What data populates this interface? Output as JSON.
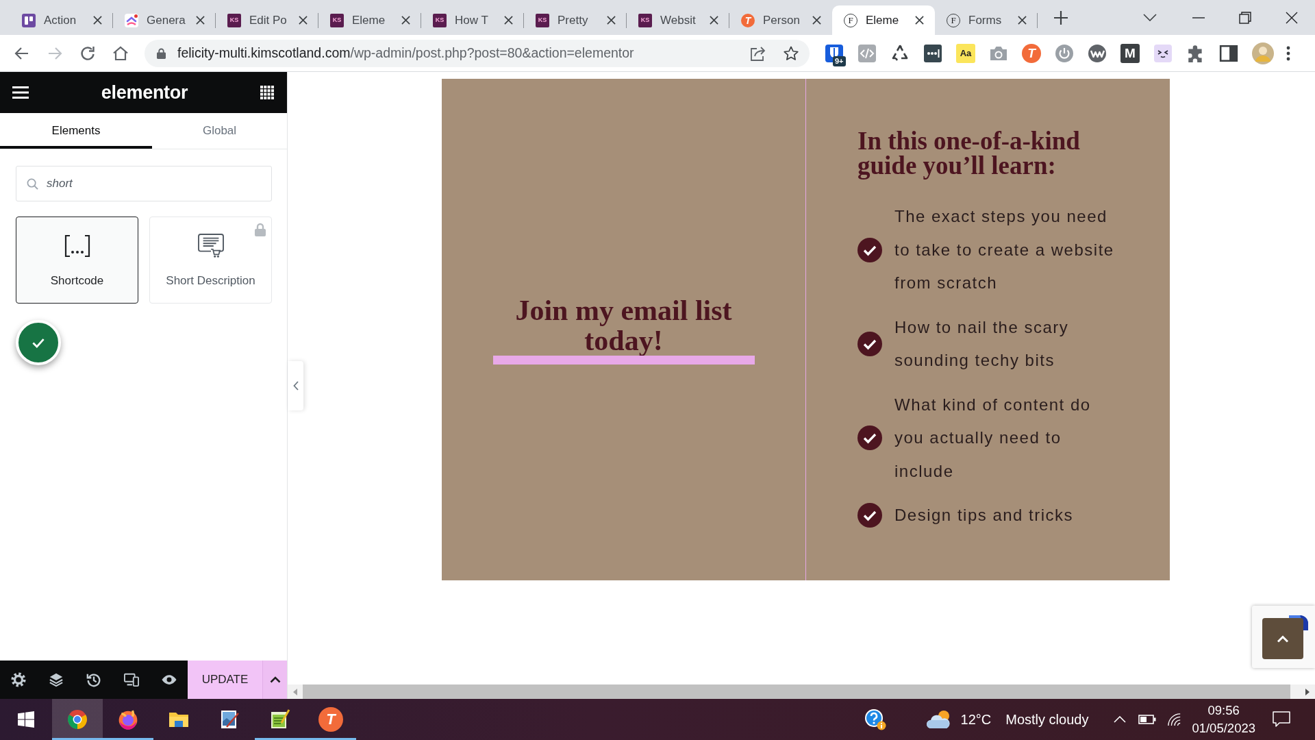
{
  "browser": {
    "tabs": [
      {
        "title": "Action",
        "kind": "board",
        "selected": false
      },
      {
        "title": "Genera",
        "kind": "swirl",
        "selected": false
      },
      {
        "title": "Edit Po",
        "kind": "monogram",
        "logo_text": "KS",
        "selected": false
      },
      {
        "title": "Eleme",
        "kind": "monogram",
        "logo_text": "KS",
        "selected": false
      },
      {
        "title": "How T",
        "kind": "monogram",
        "logo_text": "KS",
        "selected": false
      },
      {
        "title": "Pretty",
        "kind": "monogram",
        "logo_text": "KS",
        "selected": false
      },
      {
        "title": "Websit",
        "kind": "monogram",
        "logo_text": "KS",
        "selected": false
      },
      {
        "title": "Person",
        "kind": "t-logo",
        "logo_text": "T",
        "selected": false
      },
      {
        "title": "Eleme",
        "kind": "f-logo",
        "logo_text": "F",
        "selected": true
      },
      {
        "title": "Forms",
        "kind": "f-logo",
        "logo_text": "F",
        "selected": false
      }
    ],
    "nav_buttons": [
      {
        "kind": "back",
        "disabled": false
      },
      {
        "kind": "forward",
        "disabled": true
      },
      {
        "kind": "reload",
        "disabled": false
      },
      {
        "kind": "home",
        "disabled": false
      }
    ],
    "address_bar": {
      "domain": "felicity-multi.kimscotland.com",
      "path": "/wp-admin/post.php?post=80&action=elementor"
    },
    "extensions": [
      {
        "kind": "shield",
        "badge": "9+"
      },
      {
        "kind": "code"
      },
      {
        "kind": "recycle"
      },
      {
        "kind": "dots"
      },
      {
        "kind": "dictionary",
        "label": "Aa"
      },
      {
        "kind": "camera"
      },
      {
        "kind": "t-logo",
        "label": "T"
      },
      {
        "kind": "power"
      },
      {
        "kind": "wave"
      },
      {
        "kind": "m-logo",
        "label": "M"
      },
      {
        "kind": "face"
      },
      {
        "kind": "puzzle"
      },
      {
        "kind": "side-panel"
      }
    ]
  },
  "editor_panel": {
    "logo": "elementor",
    "tabs": [
      {
        "label": "Elements",
        "selected": true
      },
      {
        "label": "Global",
        "selected": false
      }
    ],
    "search": {
      "value": "short"
    },
    "widgets": [
      {
        "label": "Shortcode",
        "kind": "brackets",
        "selected": true,
        "locked": false
      },
      {
        "label": "Short Description",
        "kind": "description",
        "selected": false,
        "locked": true
      }
    ],
    "update_button": "UPDATE"
  },
  "canvas": {
    "left_heading": "Join my email list today!",
    "right_heading": "In this one-of-a-kind guide you’ll learn:",
    "list": [
      "The exact steps you need to take to create a website from scratch",
      "How to nail the scary sounding techy bits",
      "What kind of content do you actually need to include",
      "Design tips and tricks"
    ]
  },
  "taskbar": {
    "apps": [
      {
        "kind": "browser",
        "running": true,
        "selected": true
      },
      {
        "kind": "fox-browser",
        "running": true,
        "selected": false
      },
      {
        "kind": "folder",
        "running": false,
        "selected": false
      },
      {
        "kind": "paint",
        "running": false,
        "selected": false
      },
      {
        "kind": "notepad",
        "running": true,
        "selected": false
      },
      {
        "kind": "t-logo",
        "label": "T",
        "running": true,
        "selected": false
      }
    ],
    "weather": {
      "temperature": "12°C",
      "condition": "Mostly cloudy"
    },
    "clock": {
      "time": "09:56",
      "date": "01/05/2023"
    }
  }
}
